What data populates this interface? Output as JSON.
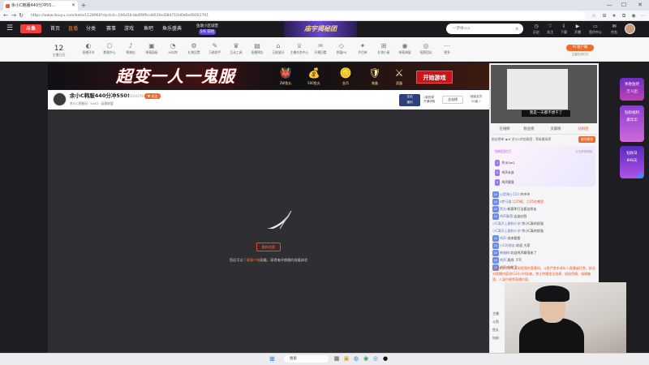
{
  "browser": {
    "tab_title": "余小C韩服440分冲55...",
    "url": "https://www.douyu.com/beta/1128960?dyshid=166d16-bb4f0f0cd461fed384710d0d0e00001701",
    "new_tab": "+",
    "window_controls": [
      "—",
      "☐",
      "✕"
    ]
  },
  "topnav": {
    "menu_icon": "menu-icon",
    "logo": "斗鱼",
    "links": [
      "首页",
      "直播",
      "分类",
      "赛事",
      "游戏",
      "鱼吧",
      "鱼乐盛典"
    ],
    "active_link": "直播",
    "promo_line1": "鱼塘小区城堡",
    "promo_badge": "5/6 前往",
    "banner_text": "庙宇揭秘团",
    "search_placeholder": "一梦缘sca",
    "icons": [
      {
        "glyph": "◷",
        "label": "历史"
      },
      {
        "glyph": "♡",
        "label": "关注"
      },
      {
        "glyph": "⇩",
        "label": "下载"
      },
      {
        "glyph": "▶",
        "label": "开播"
      },
      {
        "glyph": "▭",
        "label": "签约中心"
      },
      {
        "glyph": "✉",
        "label": "任务"
      }
    ]
  },
  "catbar": {
    "date_num": "12",
    "date_label": "主播日历",
    "items": [
      {
        "glyph": "◐",
        "label": "直播开关"
      },
      {
        "glyph": "⬡",
        "label": "数据中心"
      },
      {
        "glyph": "♪",
        "label": "预演出"
      },
      {
        "glyph": "▣",
        "label": "弹幕面板"
      },
      {
        "glyph": "◔",
        "label": "AI礼物"
      },
      {
        "glyph": "⚙",
        "label": "礼物设置"
      },
      {
        "glyph": "✎",
        "label": "万能助手"
      },
      {
        "glyph": "♛",
        "label": "互动工具"
      },
      {
        "glyph": "▤",
        "label": "直播预告"
      },
      {
        "glyph": "⌂",
        "label": "正能量分"
      },
      {
        "glyph": "♕",
        "label": "主播任务中心"
      },
      {
        "glyph": "♒",
        "label": "开播回看"
      },
      {
        "glyph": "◇",
        "label": "颜值PK"
      },
      {
        "glyph": "✦",
        "label": "节目单"
      },
      {
        "glyph": "⊞",
        "label": "礼物小屋"
      },
      {
        "glyph": "◉",
        "label": "弹幕弹窗"
      },
      {
        "glyph": "◎",
        "label": "观察团队"
      },
      {
        "glyph": "⋯",
        "label": "更多"
      }
    ],
    "pc_client": "PC客户端",
    "pc_client_sub": "主播在线时长"
  },
  "ad": {
    "title": "超变一人一鬼服",
    "prizes": [
      {
        "glyph": "👹",
        "label": "2W鱼丸"
      },
      {
        "glyph": "💰",
        "label": "500鱼丸"
      },
      {
        "glyph": "🪙",
        "label": "金币"
      },
      {
        "glyph": "🛡",
        "label": "装备"
      },
      {
        "glyph": "⚔",
        "label": "武器"
      }
    ],
    "cta": "开始游戏"
  },
  "stream": {
    "title": "余小C韩服440分冲550!",
    "room_id": "5164378",
    "follow": "♥ 关注",
    "meta": "余小C直播间 · 5443 · 英雄联盟",
    "card_text": "全站\n福利",
    "card_desc": "1星勋章\n开通领取",
    "card_btn": "全站榜",
    "level": "超级会员\n20级 ⚡"
  },
  "player": {
    "retry": "重新加载",
    "msg_prefix": "您还可以",
    "msg_link": "下载客户端",
    "msg_suffix": "观看，获得电评换播的观看体验"
  },
  "rightpanel": {
    "thumb_caption": "我是一天都不想干了",
    "tabs": [
      "在线榜",
      "粉丝榜",
      "贡献榜",
      "贵宾席",
      "钻粉团"
    ],
    "active_tab": "钻粉团",
    "rank_label": "粉丝榜单 ◀  ⊕ 余小C的钻粉团：等级最高榜",
    "rank_btn": "成为粉丝",
    "fan_head": "钻粉回忆日",
    "fan_head_right": "今日获得成就",
    "fans": [
      {
        "badge": "1",
        "name": "秀水QaQ"
      },
      {
        "badge": "2",
        "name": "鸡声未逝"
      },
      {
        "badge": "3",
        "name": "鸡声飘落"
      }
    ],
    "chat": [
      {
        "lv": "LV",
        "user": "火箭骑士123:",
        "text": "冲冲冲"
      },
      {
        "lv": "LV",
        "user": "a梦马逢:",
        "text": "江25框，江25在哪里",
        "red": true
      },
      {
        "lv": "LV",
        "user": "黑光:",
        "text": "新赛季打法要这样走"
      },
      {
        "lv": "LV",
        "user": "鸡声飘落:",
        "text": "这波必胜"
      },
      {
        "lv": "",
        "user": "小C离开上路和小学:",
        "text": "余小C真的很强",
        "red": false
      },
      {
        "lv": "",
        "user": "小C离开上路和小学:",
        "text": "余小C真的很强"
      },
      {
        "lv": "LV",
        "user": "鸡声:",
        "text": "进来看看"
      },
      {
        "lv": "LV",
        "user": "小C的朋友:",
        "text": "欢迎 大家"
      },
      {
        "lv": "LV",
        "user": "韩服粉:",
        "text": "欢迎鸡声飘落来了"
      },
      {
        "lv": "LV",
        "user": "鸡声:",
        "text": "离线（FF）"
      },
      {
        "lv": "LV",
        "user": "鸡声:",
        "text": "钻粉了"
      }
    ],
    "sysmsg": "欢迎来到余小C真的很强的直播间。斗鱼严禁未成年人直播或打赏，依法对直播内容进行24小时巡查。禁止传播违法违规、低俗色情、吸烟酗酒、人身伤害等直播内容。",
    "side_labels": [
      "主播",
      "斗鱼",
      "鱼丸",
      "钻粉"
    ]
  },
  "farright": {
    "ad1": "青春鱼吧\n万人团",
    "ad2": "钻粉福利\n嘉年华",
    "ad3": "钻粉日\n8¥8天"
  },
  "taskbar": {
    "search_label": "搜索",
    "apps": [
      "▦",
      "▣",
      "◍",
      "◉",
      "◎",
      "●"
    ]
  }
}
